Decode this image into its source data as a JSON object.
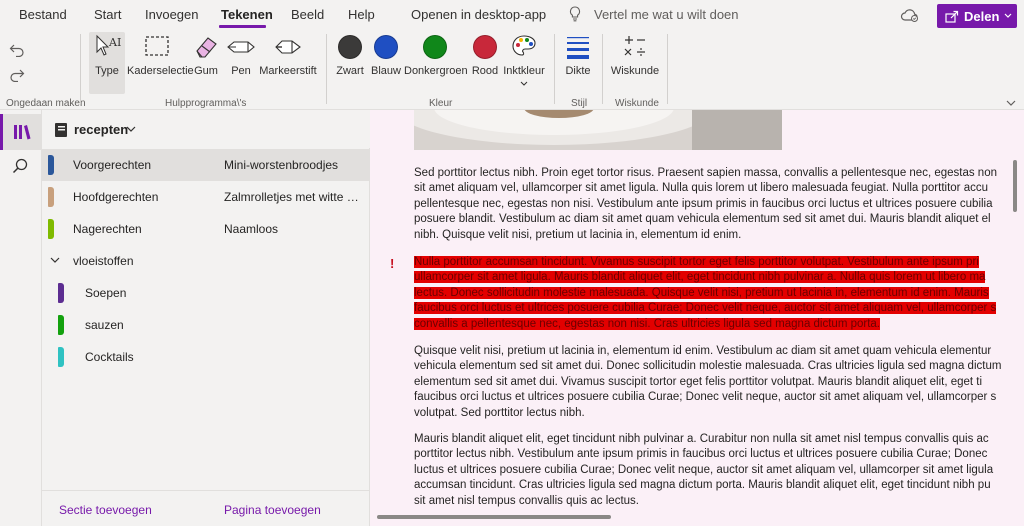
{
  "menu": {
    "items": [
      "Bestand",
      "Start",
      "Invoegen",
      "Tekenen",
      "Beeld",
      "Help"
    ],
    "active": "Tekenen",
    "open_desktop": "Openen in desktop-app",
    "tell_me": "Vertel me wat u wilt doen",
    "share": "Delen"
  },
  "ribbon": {
    "undo_group": "Ongedaan maken",
    "tools": {
      "type": "Type",
      "kaderselectie": "Kaderselectie",
      "gum": "Gum",
      "pen": "Pen",
      "markeerstift": "Markeerstift",
      "group": "Hulpprogramma\\'s"
    },
    "colors": {
      "zwart": "Zwart",
      "blauw": "Blauw",
      "donkergroen": "Donkergroen",
      "rood": "Rood",
      "inktkleur": "Inktkleur",
      "group": "Kleur",
      "values": {
        "zwart": "#3b3a39",
        "blauw": "#1f4fc2",
        "donkergroen": "#10871a",
        "rood": "#c8283a"
      }
    },
    "stijl": {
      "dikte": "Dikte",
      "group": "Stijl"
    },
    "wiskunde": {
      "label": "Wiskunde",
      "group": "Wiskunde"
    }
  },
  "notebook": {
    "title": "recepten"
  },
  "sections": [
    {
      "label": "Voorgerechten",
      "color": "#2b579a",
      "active": true
    },
    {
      "label": "Hoofdgerechten",
      "color": "#c8a07d"
    },
    {
      "label": "Nagerechten",
      "color": "#7fba00"
    },
    {
      "label": "vloeistoffen",
      "group": true
    },
    {
      "label": "Soepen",
      "color": "#5c2d91",
      "child": true
    },
    {
      "label": "sauzen",
      "color": "#13a10e",
      "child": true
    },
    {
      "label": "Cocktails",
      "color": "#2fc2c2",
      "child": true
    }
  ],
  "pages": [
    {
      "label": "Mini-worstenbroodjes",
      "active": true
    },
    {
      "label": "Zalmrolletjes met witte kaas"
    },
    {
      "label": "Naamloos"
    }
  ],
  "footer": {
    "add_section": "Sectie toevoegen",
    "add_page": "Pagina toevoegen"
  },
  "content": {
    "p1": [
      "Sed porttitor lectus nibh. Proin eget tortor risus. Praesent sapien massa, convallis a pellentesque nec, egestas non",
      "sit amet aliquam vel, ullamcorper sit amet ligula. Nulla quis lorem ut libero malesuada feugiat. Nulla porttitor accu",
      "pellentesque nec, egestas non nisi. Vestibulum ante ipsum primis in faucibus orci luctus et ultrices posuere cubilia",
      "posuere blandit. Vestibulum ac diam sit amet quam vehicula elementum sed sit amet dui. Mauris blandit aliquet el",
      "nibh. Quisque velit nisi, pretium ut lacinia in, elementum id enim."
    ],
    "exclaim": "!",
    "p2": [
      "Nulla porttitor accumsan tincidunt. Vivamus suscipit tortor eget felis porttitor volutpat. Vestibulum ante ipsum pri",
      "ullamcorper sit amet ligula. Mauris blandit aliquet elit, eget tincidunt nibh pulvinar a. Nulla quis lorem ut libero ma",
      "lectus. Donec sollicitudin molestie malesuada. Quisque velit nisi, pretium ut lacinia in, elementum id enim. Mauris",
      "faucibus orci luctus et ultrices posuere cubilia Curae; Donec velit neque, auctor sit amet aliquam vel, ullamcorper s",
      "convallis a pellentesque nec, egestas non nisi. Cras ultricies ligula sed magna dictum porta."
    ],
    "p3": [
      "Quisque velit nisi, pretium ut lacinia in, elementum id enim. Vestibulum ac diam sit amet quam vehicula elementur",
      "vehicula elementum sed sit amet dui. Donec sollicitudin molestie malesuada. Cras ultricies ligula sed magna dictum",
      "elementum sed sit amet dui. Vivamus suscipit tortor eget felis porttitor volutpat. Mauris blandit aliquet elit, eget ti",
      "faucibus orci luctus et ultrices posuere cubilia Curae; Donec velit neque, auctor sit amet aliquam vel, ullamcorper s",
      "volutpat. Sed porttitor lectus nibh."
    ],
    "p4": [
      "Mauris blandit aliquet elit, eget tincidunt nibh pulvinar a. Curabitur non nulla sit amet nisl tempus convallis quis ac",
      "porttitor lectus nibh. Vestibulum ante ipsum primis in faucibus orci luctus et ultrices posuere cubilia Curae; Donec",
      "luctus et ultrices posuere cubilia Curae; Donec velit neque, auctor sit amet aliquam vel, ullamcorper sit amet ligula",
      "accumsan tincidunt. Cras ultricies ligula sed magna dictum porta. Mauris blandit aliquet elit, eget tincidunt nibh pu",
      "sit amet nisl tempus convallis quis ac lectus."
    ]
  }
}
